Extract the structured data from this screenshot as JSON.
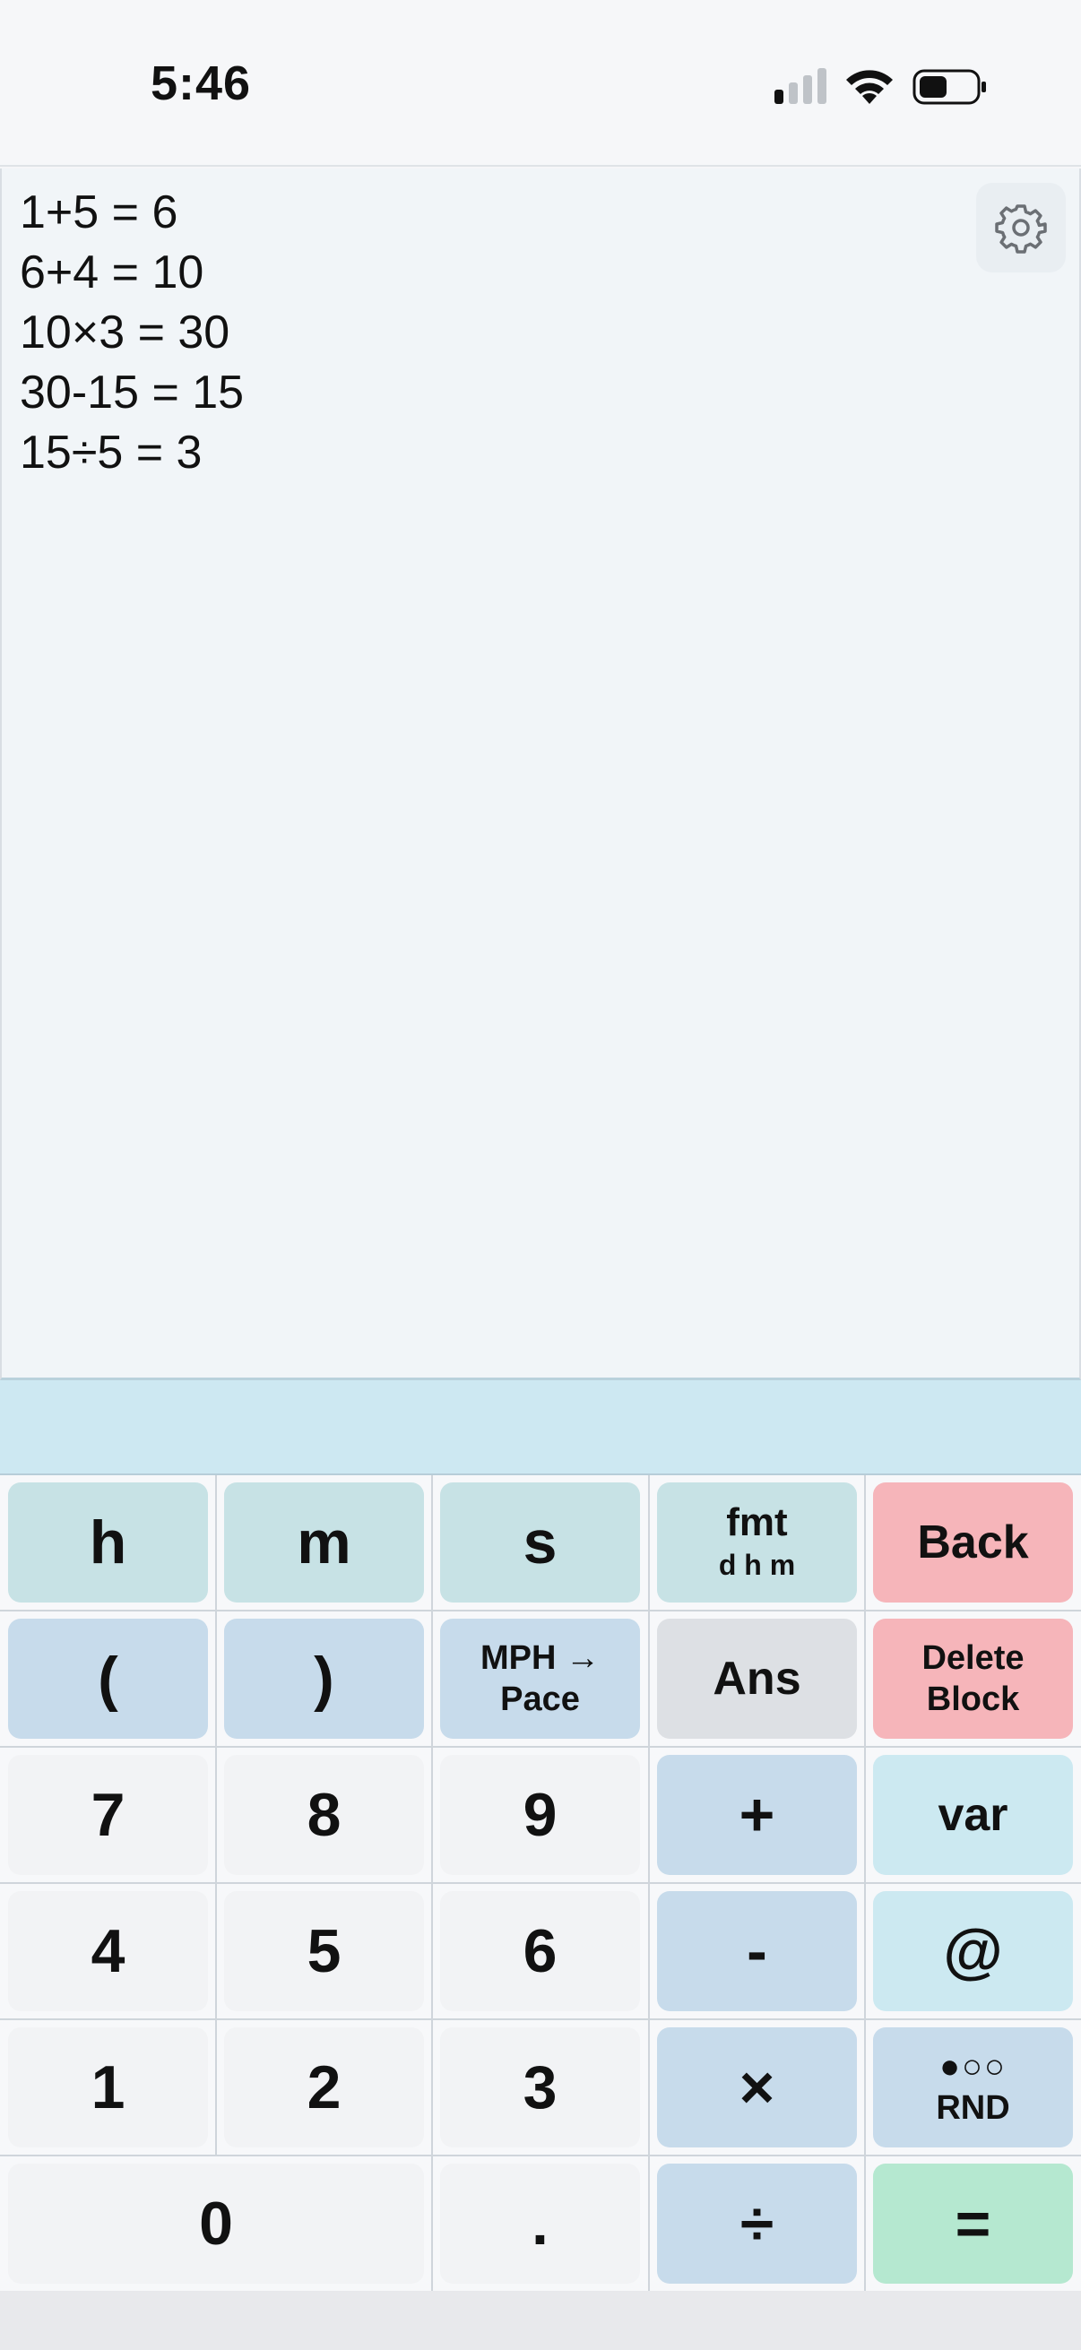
{
  "status_bar": {
    "time": "5:46"
  },
  "history": {
    "lines": [
      "1+5 = 6",
      "6+4 = 10",
      "10×3 = 30",
      "30-15 = 15",
      "15÷5 = 3"
    ]
  },
  "input": {
    "value": ""
  },
  "keys": {
    "h": "h",
    "m": "m",
    "s": "s",
    "fmt_top": "fmt",
    "fmt_bottom": "d h m",
    "back": "Back",
    "open_paren": "(",
    "close_paren": ")",
    "mph_top": "MPH →",
    "mph_bottom": "Pace",
    "ans": "Ans",
    "delete_top": "Delete",
    "delete_bottom": "Block",
    "seven": "7",
    "eight": "8",
    "nine": "9",
    "plus": "+",
    "var": "var",
    "four": "4",
    "five": "5",
    "six": "6",
    "minus": "-",
    "at": "@",
    "one": "1",
    "two": "2",
    "three": "3",
    "times": "×",
    "rnd_top": "●○○",
    "rnd_bottom": "RND",
    "zero": "0",
    "dot": ".",
    "divide": "÷",
    "equals": "="
  },
  "colors": {
    "time_key": "#c7e2e5",
    "operator_key": "#c7dbeb",
    "danger_key": "#f6b5ba",
    "equals_key": "#b5e8d0",
    "input_strip": "#cde8f2"
  }
}
